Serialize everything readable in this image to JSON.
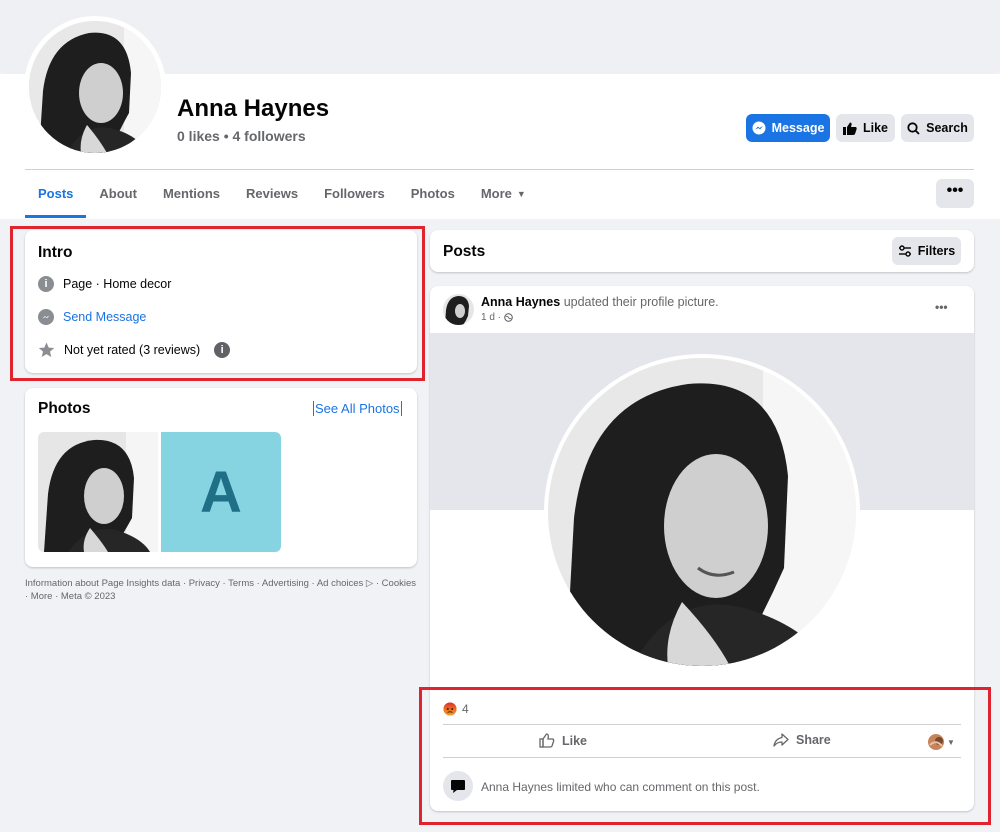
{
  "profile": {
    "name": "Anna Haynes",
    "stats": "0 likes • 4 followers"
  },
  "header_buttons": {
    "message": "Message",
    "like": "Like",
    "search": "Search"
  },
  "tabs": [
    {
      "label": "Posts",
      "active": true
    },
    {
      "label": "About"
    },
    {
      "label": "Mentions"
    },
    {
      "label": "Reviews"
    },
    {
      "label": "Followers"
    },
    {
      "label": "Photos"
    },
    {
      "label": "More"
    }
  ],
  "more_menu": "•••",
  "intro": {
    "title": "Intro",
    "category": "Page · Home decor",
    "send_message": "Send Message",
    "rating": "Not yet rated (3 reviews)"
  },
  "photos": {
    "title": "Photos",
    "see_all": "See All Photos",
    "letter_tile": "A",
    "tile_color": "#86d3e1",
    "tile_letter_color": "#1f6f87"
  },
  "footer": {
    "line": "Information about Page Insights data · Privacy · Terms · Advertising · Ad choices ▷ · Cookies · More · Meta © 2023"
  },
  "posts": {
    "title": "Posts",
    "filters": "Filters"
  },
  "post": {
    "author": "Anna Haynes",
    "action_text": "updated their profile picture.",
    "time": "1 d ·",
    "menu": "•••",
    "reaction_count": "4",
    "like": "Like",
    "share": "Share",
    "comment_notice": "Anna Haynes limited who can comment on this post."
  },
  "colors": {
    "accent": "#1b74e4",
    "highlight": "#e0242f"
  }
}
